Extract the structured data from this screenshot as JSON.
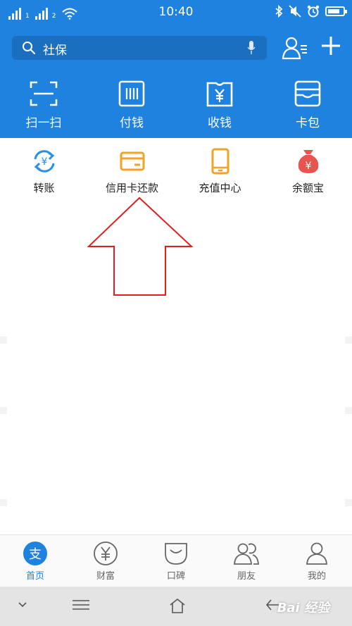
{
  "status_bar": {
    "time": "10:40",
    "sim1": "1",
    "sim2": "2"
  },
  "search": {
    "query": "社保"
  },
  "quick_actions": [
    {
      "label": "扫一扫",
      "icon": "scan-icon"
    },
    {
      "label": "付钱",
      "icon": "barcode-pay-icon"
    },
    {
      "label": "收钱",
      "icon": "receive-money-icon"
    },
    {
      "label": "卡包",
      "icon": "card-wallet-icon"
    }
  ],
  "apps": [
    {
      "label": "转账",
      "icon": "transfer-icon",
      "color": "#2b8fea"
    },
    {
      "label": "信用卡还款",
      "icon": "credit-card-icon",
      "color": "#f0a229"
    },
    {
      "label": "充值中心",
      "icon": "phone-topup-icon",
      "color": "#f0a229"
    },
    {
      "label": "余额宝",
      "icon": "money-bag-icon",
      "color": "#e8544e"
    }
  ],
  "tabs": [
    {
      "label": "首页",
      "icon": "alipay-home-icon",
      "active": true
    },
    {
      "label": "财富",
      "icon": "yuan-icon",
      "active": false
    },
    {
      "label": "口碑",
      "icon": "koubei-icon",
      "active": false
    },
    {
      "label": "朋友",
      "icon": "friends-icon",
      "active": false
    },
    {
      "label": "我的",
      "icon": "profile-icon",
      "active": false
    }
  ],
  "watermark": "Bai 经验",
  "colors": {
    "brand_blue": "#1f82de",
    "annotation_red": "#e02020"
  }
}
